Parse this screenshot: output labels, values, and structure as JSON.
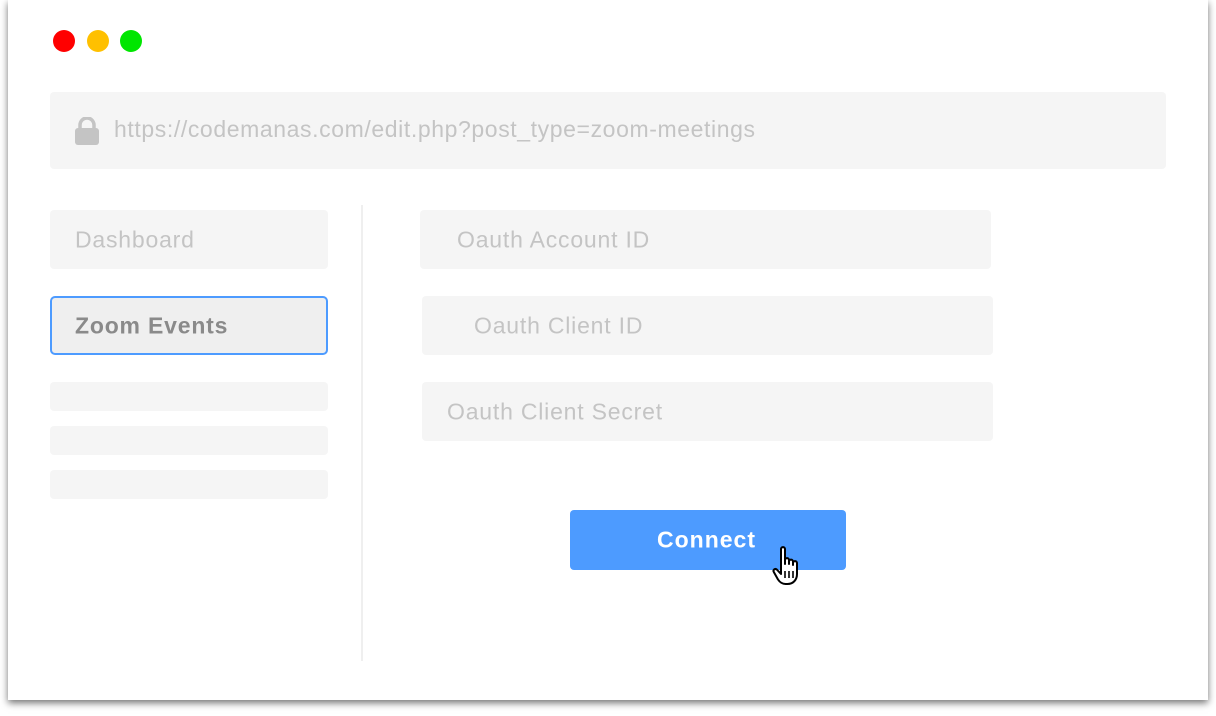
{
  "window": {
    "controls": [
      "close",
      "minimize",
      "maximize"
    ],
    "colors": {
      "close": "#ff0000",
      "minimize": "#ffc000",
      "maximize": "#00e600"
    }
  },
  "address_bar": {
    "icon": "lock-icon",
    "url": "https://codemanas.com/edit.php?post_type=zoom-meetings"
  },
  "sidebar": {
    "items": [
      {
        "label": "Dashboard",
        "active": false
      },
      {
        "label": "Zoom Events",
        "active": true
      }
    ],
    "placeholder_count": 3
  },
  "form": {
    "fields": [
      {
        "placeholder": "Oauth Account ID"
      },
      {
        "placeholder": "Oauth Client ID"
      },
      {
        "placeholder": "Oauth Client Secret"
      }
    ],
    "submit_label": "Connect"
  },
  "cursor": "hand-pointer-icon",
  "colors": {
    "accent": "#4d9bff",
    "field_background": "#f5f5f5",
    "placeholder_text": "#c4c4c4"
  }
}
